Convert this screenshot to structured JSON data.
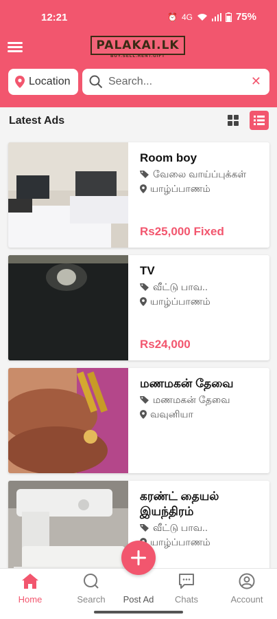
{
  "status_bar": {
    "time": "12:21",
    "network": "4G",
    "battery": "75%"
  },
  "header": {
    "logo_text": "PALAKAI.LK",
    "logo_tagline": "BUY.SELL.RENT.GIFT",
    "location_label": "Location",
    "search_placeholder": "Search..."
  },
  "listing": {
    "section_title": "Latest Ads",
    "view_mode": "list"
  },
  "ads": [
    {
      "title": "Room boy",
      "category": "வேலை வாய்ப்புக்கள்",
      "location": "யாழ்ப்பாணம்",
      "price": "Rs25,000 Fixed"
    },
    {
      "title": "TV",
      "category": "வீட்டு பாவ..",
      "location": "யாழ்ப்பாணம்",
      "price": "Rs24,000"
    },
    {
      "title": "மணமகன் தேவை",
      "category": "மணமகன் தேவை",
      "location": "வவுனியா",
      "price": ""
    },
    {
      "title": "கரண்ட் தையல் இயந்திரம்",
      "category": "வீட்டு பாவ..",
      "location": "யாழ்ப்பாணம்",
      "price": ""
    }
  ],
  "bottom_nav": {
    "home": "Home",
    "search": "Search",
    "post_ad": "Post Ad",
    "chats": "Chats",
    "account": "Account"
  },
  "colors": {
    "accent": "#f2566e",
    "header_bg": "#f2566e",
    "inactive": "#888888"
  }
}
